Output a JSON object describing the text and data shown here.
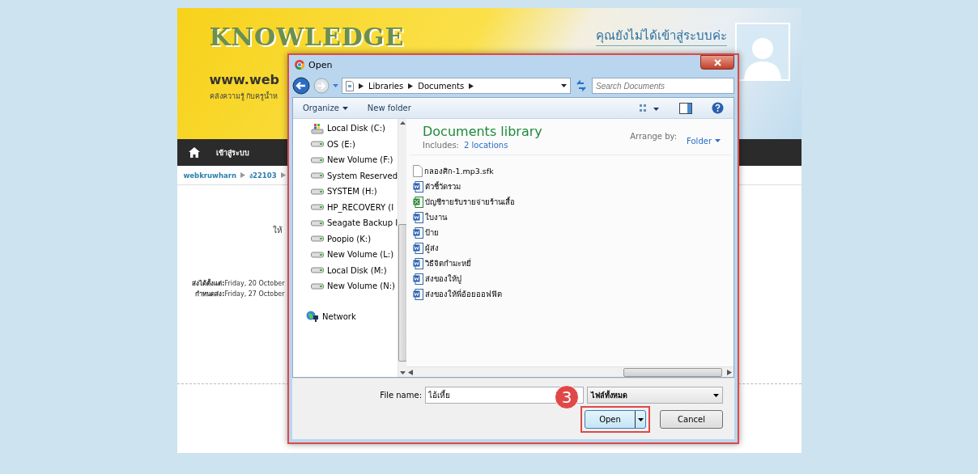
{
  "site": {
    "logo": "KNOWLEDGE",
    "url": "www.web",
    "tagline": "คลังความรู้ กับครูน้ำห",
    "login_status": "คุณยังไม่ได้เข้าสู่ระบบค่ะ",
    "nav_label": "เข้าสู่ระบบ",
    "breadcrumb": [
      "webkruwharn",
      "ง22103"
    ],
    "partial_text": "ให้",
    "dates": [
      "**ส่งได้ตั้งแต่:**Friday, 20 October",
      "**กำหนดส่ง:**Friday, 27 October"
    ]
  },
  "dialog": {
    "title": "Open",
    "address": [
      "Libraries",
      "Documents"
    ],
    "search": {
      "placeholder": "Search Documents"
    },
    "organize": "Organize",
    "new_folder": "New folder",
    "nav_items": [
      {
        "label": "Local Disk (C:)",
        "kind": "system"
      },
      {
        "label": "OS (E:)",
        "kind": "drive"
      },
      {
        "label": "New Volume (F:)",
        "kind": "drive"
      },
      {
        "label": "System Reserved",
        "kind": "drive"
      },
      {
        "label": "SYSTEM (H:)",
        "kind": "drive"
      },
      {
        "label": "HP_RECOVERY (I",
        "kind": "drive"
      },
      {
        "label": "Seagate Backup I",
        "kind": "drive"
      },
      {
        "label": "Poopio (K:)",
        "kind": "drive"
      },
      {
        "label": "New Volume (L:)",
        "kind": "drive"
      },
      {
        "label": "Local Disk (M:)",
        "kind": "drive"
      },
      {
        "label": "New Volume (N:)",
        "kind": "drive"
      },
      {
        "label": "Network",
        "kind": "network"
      }
    ],
    "library": {
      "title": "Documents library",
      "includes_label": "Includes:",
      "includes_link": "2 locations",
      "arrange_label": "Arrange by:",
      "arrange_value": "Folder"
    },
    "files": [
      {
        "name": "กลองศิก-1.mp3.sfk",
        "kind": "blank"
      },
      {
        "name": "ตัวชี้วัดรวม",
        "kind": "word"
      },
      {
        "name": "บัญชีรายรับรายจ่ายร้านเสื้อ",
        "kind": "excel"
      },
      {
        "name": "ใบงาน",
        "kind": "word"
      },
      {
        "name": "ป้าย",
        "kind": "word"
      },
      {
        "name": "ผู้ส่ง",
        "kind": "word"
      },
      {
        "name": "วิธีจิตกำมะหยี่",
        "kind": "word"
      },
      {
        "name": "ส่งของให้ปู",
        "kind": "word"
      },
      {
        "name": "ส่งของให้พี่อ้อยออฟฟิต",
        "kind": "word"
      }
    ],
    "file_name": {
      "label": "File name:",
      "value": "ไอ้เหี้ย"
    },
    "file_type": "ไฟล์ทั้งหมด",
    "open": "Open",
    "cancel": "Cancel",
    "step": "3"
  }
}
